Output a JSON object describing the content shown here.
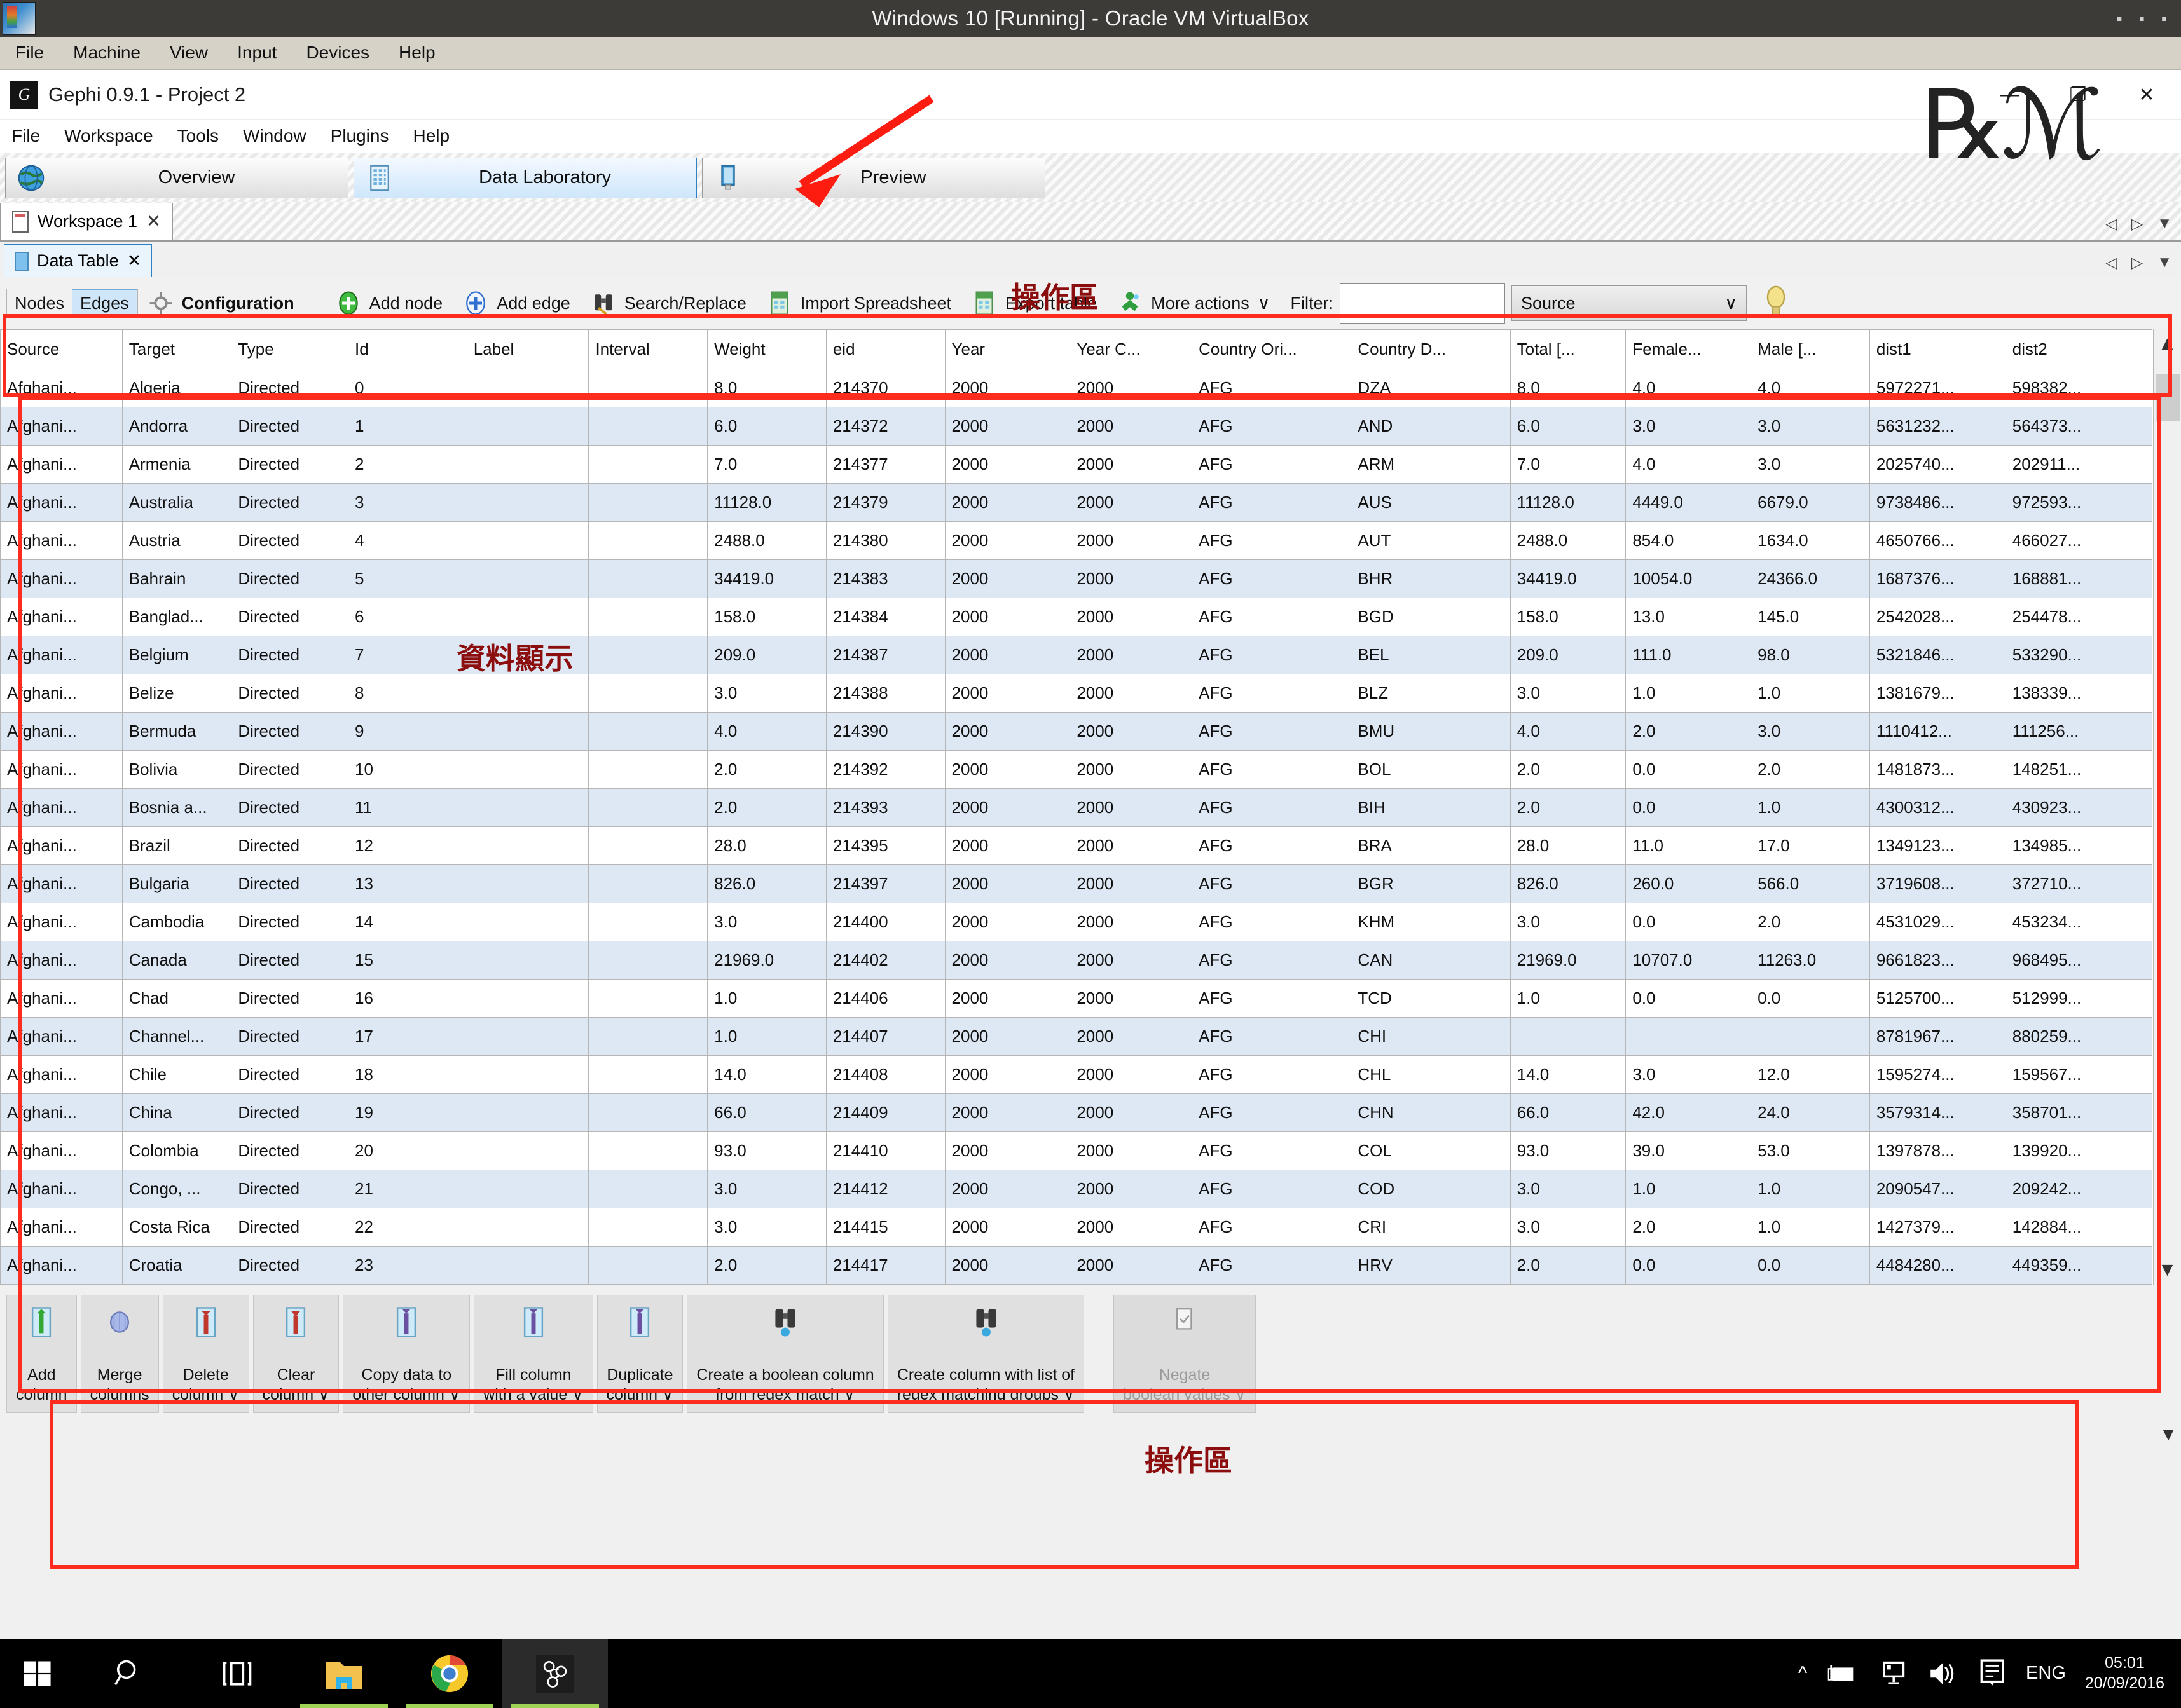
{
  "vbox": {
    "title": "Windows 10 [Running] - Oracle VM VirtualBox",
    "menus": [
      "File",
      "Machine",
      "View",
      "Input",
      "Devices",
      "Help"
    ],
    "window_buttons": [
      "minimize-icon",
      "maximize-icon",
      "close-icon"
    ]
  },
  "gephi": {
    "title": "Gephi 0.9.1 - Project 2",
    "menus": [
      "File",
      "Workspace",
      "Tools",
      "Window",
      "Plugins",
      "Help"
    ],
    "window_buttons": {
      "minimize": "—",
      "maximize": "❐",
      "close": "✕"
    },
    "mode_tabs": [
      {
        "label": "Overview",
        "icon": "globe-icon",
        "active": false
      },
      {
        "label": "Data Laboratory",
        "icon": "table-icon",
        "active": true
      },
      {
        "label": "Preview",
        "icon": "preview-icon",
        "active": false
      }
    ],
    "workspace_tab": {
      "label": "Workspace 1",
      "close": "✕"
    },
    "doc_tab": {
      "label": "Data Table",
      "close": "✕"
    }
  },
  "toolbar": {
    "nodes_label": "Nodes",
    "edges_label": "Edges",
    "configuration_label": "Configuration",
    "add_node_label": "Add node",
    "add_edge_label": "Add edge",
    "search_replace_label": "Search/Replace",
    "import_spreadsheet_label": "Import Spreadsheet",
    "export_table_label": "Export table",
    "more_actions_label": "More actions",
    "more_actions_caret": "∨",
    "filter_label": "Filter:",
    "filter_value": "",
    "filter_column_value": "Source",
    "filter_column_caret": "∨"
  },
  "annotations": [
    {
      "text": "操作區",
      "id": "top-operation-area"
    },
    {
      "text": "資料顯示",
      "id": "data-display-area"
    },
    {
      "text": "操作區",
      "id": "bottom-operation-area"
    }
  ],
  "table": {
    "columns": [
      "Source",
      "Target",
      "Type",
      "Id",
      "Label",
      "Interval",
      "Weight",
      "eid",
      "Year",
      "Year C...",
      "Country Ori...",
      "Country D...",
      "Total [...",
      "Female...",
      "Male [...",
      "dist1",
      "dist2"
    ],
    "rows": [
      [
        "Afghani...",
        "Algeria",
        "Directed",
        "0",
        "",
        "",
        "8.0",
        "214370",
        "2000",
        "2000",
        "AFG",
        "DZA",
        "8.0",
        "4.0",
        "4.0",
        "5972271...",
        "598382..."
      ],
      [
        "Afghani...",
        "Andorra",
        "Directed",
        "1",
        "",
        "",
        "6.0",
        "214372",
        "2000",
        "2000",
        "AFG",
        "AND",
        "6.0",
        "3.0",
        "3.0",
        "5631232...",
        "564373..."
      ],
      [
        "Afghani...",
        "Armenia",
        "Directed",
        "2",
        "",
        "",
        "7.0",
        "214377",
        "2000",
        "2000",
        "AFG",
        "ARM",
        "7.0",
        "4.0",
        "3.0",
        "2025740...",
        "202911..."
      ],
      [
        "Afghani...",
        "Australia",
        "Directed",
        "3",
        "",
        "",
        "11128.0",
        "214379",
        "2000",
        "2000",
        "AFG",
        "AUS",
        "11128.0",
        "4449.0",
        "6679.0",
        "9738486...",
        "972593..."
      ],
      [
        "Afghani...",
        "Austria",
        "Directed",
        "4",
        "",
        "",
        "2488.0",
        "214380",
        "2000",
        "2000",
        "AFG",
        "AUT",
        "2488.0",
        "854.0",
        "1634.0",
        "4650766...",
        "466027..."
      ],
      [
        "Afghani...",
        "Bahrain",
        "Directed",
        "5",
        "",
        "",
        "34419.0",
        "214383",
        "2000",
        "2000",
        "AFG",
        "BHR",
        "34419.0",
        "10054.0",
        "24366.0",
        "1687376...",
        "168881..."
      ],
      [
        "Afghani...",
        "Banglad...",
        "Directed",
        "6",
        "",
        "",
        "158.0",
        "214384",
        "2000",
        "2000",
        "AFG",
        "BGD",
        "158.0",
        "13.0",
        "145.0",
        "2542028...",
        "254478..."
      ],
      [
        "Afghani...",
        "Belgium",
        "Directed",
        "7",
        "",
        "",
        "209.0",
        "214387",
        "2000",
        "2000",
        "AFG",
        "BEL",
        "209.0",
        "111.0",
        "98.0",
        "5321846...",
        "533290..."
      ],
      [
        "Afghani...",
        "Belize",
        "Directed",
        "8",
        "",
        "",
        "3.0",
        "214388",
        "2000",
        "2000",
        "AFG",
        "BLZ",
        "3.0",
        "1.0",
        "1.0",
        "1381679...",
        "138339..."
      ],
      [
        "Afghani...",
        "Bermuda",
        "Directed",
        "9",
        "",
        "",
        "4.0",
        "214390",
        "2000",
        "2000",
        "AFG",
        "BMU",
        "4.0",
        "2.0",
        "3.0",
        "1110412...",
        "111256..."
      ],
      [
        "Afghani...",
        "Bolivia",
        "Directed",
        "10",
        "",
        "",
        "2.0",
        "214392",
        "2000",
        "2000",
        "AFG",
        "BOL",
        "2.0",
        "0.0",
        "2.0",
        "1481873...",
        "148251..."
      ],
      [
        "Afghani...",
        "Bosnia a...",
        "Directed",
        "11",
        "",
        "",
        "2.0",
        "214393",
        "2000",
        "2000",
        "AFG",
        "BIH",
        "2.0",
        "0.0",
        "1.0",
        "4300312...",
        "430923..."
      ],
      [
        "Afghani...",
        "Brazil",
        "Directed",
        "12",
        "",
        "",
        "28.0",
        "214395",
        "2000",
        "2000",
        "AFG",
        "BRA",
        "28.0",
        "11.0",
        "17.0",
        "1349123...",
        "134985..."
      ],
      [
        "Afghani...",
        "Bulgaria",
        "Directed",
        "13",
        "",
        "",
        "826.0",
        "214397",
        "2000",
        "2000",
        "AFG",
        "BGR",
        "826.0",
        "260.0",
        "566.0",
        "3719608...",
        "372710..."
      ],
      [
        "Afghani...",
        "Cambodia",
        "Directed",
        "14",
        "",
        "",
        "3.0",
        "214400",
        "2000",
        "2000",
        "AFG",
        "KHM",
        "3.0",
        "0.0",
        "2.0",
        "4531029...",
        "453234..."
      ],
      [
        "Afghani...",
        "Canada",
        "Directed",
        "15",
        "",
        "",
        "21969.0",
        "214402",
        "2000",
        "2000",
        "AFG",
        "CAN",
        "21969.0",
        "10707.0",
        "11263.0",
        "9661823...",
        "968495..."
      ],
      [
        "Afghani...",
        "Chad",
        "Directed",
        "16",
        "",
        "",
        "1.0",
        "214406",
        "2000",
        "2000",
        "AFG",
        "TCD",
        "1.0",
        "0.0",
        "0.0",
        "5125700...",
        "512999..."
      ],
      [
        "Afghani...",
        "Channel...",
        "Directed",
        "17",
        "",
        "",
        "1.0",
        "214407",
        "2000",
        "2000",
        "AFG",
        "CHI",
        "",
        "",
        "",
        "8781967...",
        "880259..."
      ],
      [
        "Afghani...",
        "Chile",
        "Directed",
        "18",
        "",
        "",
        "14.0",
        "214408",
        "2000",
        "2000",
        "AFG",
        "CHL",
        "14.0",
        "3.0",
        "12.0",
        "1595274...",
        "159567..."
      ],
      [
        "Afghani...",
        "China",
        "Directed",
        "19",
        "",
        "",
        "66.0",
        "214409",
        "2000",
        "2000",
        "AFG",
        "CHN",
        "66.0",
        "42.0",
        "24.0",
        "3579314...",
        "358701..."
      ],
      [
        "Afghani...",
        "Colombia",
        "Directed",
        "20",
        "",
        "",
        "93.0",
        "214410",
        "2000",
        "2000",
        "AFG",
        "COL",
        "93.0",
        "39.0",
        "53.0",
        "1397878...",
        "139920..."
      ],
      [
        "Afghani...",
        "Congo, ...",
        "Directed",
        "21",
        "",
        "",
        "3.0",
        "214412",
        "2000",
        "2000",
        "AFG",
        "COD",
        "3.0",
        "1.0",
        "1.0",
        "2090547...",
        "209242..."
      ],
      [
        "Afghani...",
        "Costa Rica",
        "Directed",
        "22",
        "",
        "",
        "3.0",
        "214415",
        "2000",
        "2000",
        "AFG",
        "CRI",
        "3.0",
        "2.0",
        "1.0",
        "1427379...",
        "142884..."
      ],
      [
        "Afghani...",
        "Croatia",
        "Directed",
        "23",
        "",
        "",
        "2.0",
        "214417",
        "2000",
        "2000",
        "AFG",
        "HRV",
        "2.0",
        "0.0",
        "0.0",
        "4484280...",
        "449359..."
      ]
    ]
  },
  "bottom_toolbar": {
    "buttons": [
      {
        "id": "add-column",
        "lines": [
          "Add",
          "column"
        ],
        "icon": "column-add-icon",
        "caret": false,
        "disabled": false
      },
      {
        "id": "merge-columns",
        "lines": [
          "Merge",
          "columns"
        ],
        "icon": "merge-icon",
        "caret": false,
        "disabled": false
      },
      {
        "id": "delete-column",
        "lines": [
          "Delete",
          "column"
        ],
        "icon": "column-delete-icon",
        "caret": true,
        "disabled": false
      },
      {
        "id": "clear-column",
        "lines": [
          "Clear",
          "column"
        ],
        "icon": "column-clear-icon",
        "caret": true,
        "disabled": false
      },
      {
        "id": "copy-data-to-other-column",
        "lines": [
          "Copy data to",
          "other column"
        ],
        "icon": "column-copy-icon",
        "caret": true,
        "disabled": false
      },
      {
        "id": "fill-column-with-a-value",
        "lines": [
          "Fill column",
          "with a value"
        ],
        "icon": "column-fill-icon",
        "caret": true,
        "disabled": false
      },
      {
        "id": "duplicate-column",
        "lines": [
          "Duplicate",
          "column"
        ],
        "icon": "column-duplicate-icon",
        "caret": true,
        "disabled": false
      },
      {
        "id": "create-a-boolean-column-from-regex-match",
        "lines": [
          "Create a boolean column",
          "from regex match"
        ],
        "icon": "binoculars-icon",
        "caret": true,
        "disabled": false
      },
      {
        "id": "create-column-with-list-of-regex-matching-groups",
        "lines": [
          "Create column with list of",
          "regex matching groups"
        ],
        "icon": "binoculars-icon",
        "caret": true,
        "disabled": false
      },
      {
        "id": "negate-boolean-values",
        "lines": [
          "Negate",
          "boolean values"
        ],
        "icon": "negate-icon",
        "caret": true,
        "disabled": true
      }
    ],
    "caret": "∨"
  },
  "taskbar": {
    "items": [
      {
        "id": "start",
        "icon": "windows-logo-icon"
      },
      {
        "id": "search",
        "icon": "search-icon"
      },
      {
        "id": "task-view",
        "icon": "task-view-icon"
      },
      {
        "id": "file-explorer",
        "icon": "folder-icon",
        "running": true
      },
      {
        "id": "chrome",
        "icon": "chrome-icon",
        "running": true
      },
      {
        "id": "gephi",
        "icon": "gephi-icon",
        "running": true,
        "active": true
      }
    ],
    "tray": [
      {
        "id": "show-hidden-icons",
        "icon": "chevron-up-icon"
      },
      {
        "id": "battery",
        "icon": "battery-icon"
      },
      {
        "id": "network",
        "icon": "network-icon"
      },
      {
        "id": "volume",
        "icon": "speaker-icon"
      },
      {
        "id": "action-center",
        "icon": "notification-icon"
      }
    ],
    "language": "ENG",
    "time": "05:01",
    "date": "20/09/2016"
  }
}
